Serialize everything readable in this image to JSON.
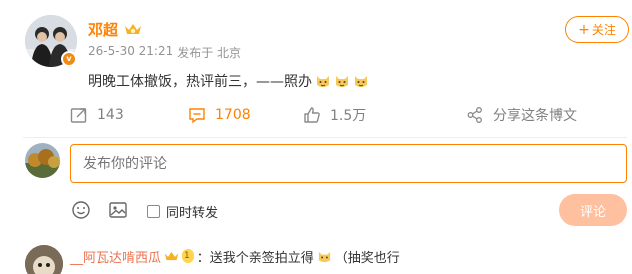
{
  "post": {
    "author": "邓超",
    "timestamp": "26-5-30 21:21",
    "source": "发布于 北京",
    "follow_label": "关注",
    "text": "明晚工体撤饭，热评前三，——照办",
    "emoji_count": 3,
    "accent_color": "#ff8200"
  },
  "actions": {
    "repost_count": "143",
    "comment_count": "1708",
    "like_count": "1.5万",
    "share_label": "分享这条博文"
  },
  "composer": {
    "placeholder": "发布你的评论",
    "repost_label": "同时转发",
    "submit_label": "评论"
  },
  "comment": {
    "user": "__阿瓦达啃西瓜",
    "level": "1",
    "text": "：送我个亲签拍立得",
    "text_suffix": "（抽奖也行"
  }
}
